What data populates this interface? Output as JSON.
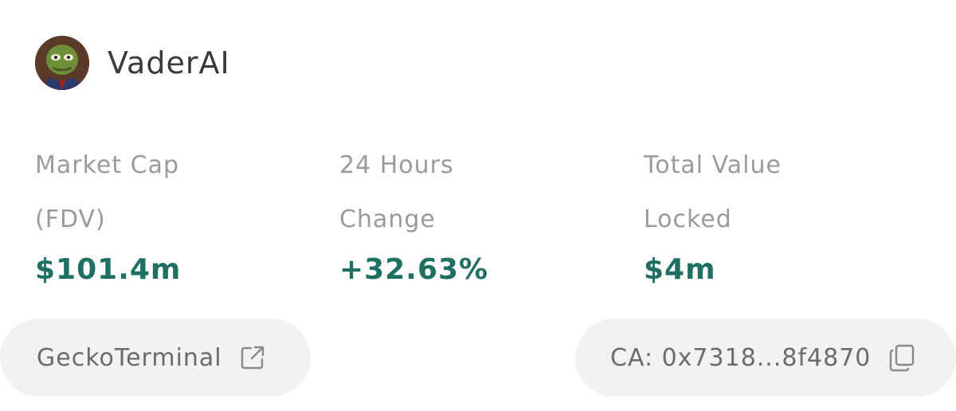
{
  "token": {
    "name": "VaderAI"
  },
  "stats": [
    {
      "label": "Market Cap\n(FDV)",
      "value": "$101.4m"
    },
    {
      "label": "24 Hours\nChange",
      "value": "+32.63%"
    },
    {
      "label": "Total Value\nLocked",
      "value": "$4m"
    }
  ],
  "links": {
    "gecko_label": "GeckoTerminal",
    "contract_label": "CA: 0x7318...8f4870"
  },
  "colors": {
    "value": "#1f6f63",
    "label": "#9a9a9a",
    "pill_bg": "#f2f2f2"
  },
  "icons": {
    "external": "external-link-icon",
    "copy": "copy-icon"
  }
}
